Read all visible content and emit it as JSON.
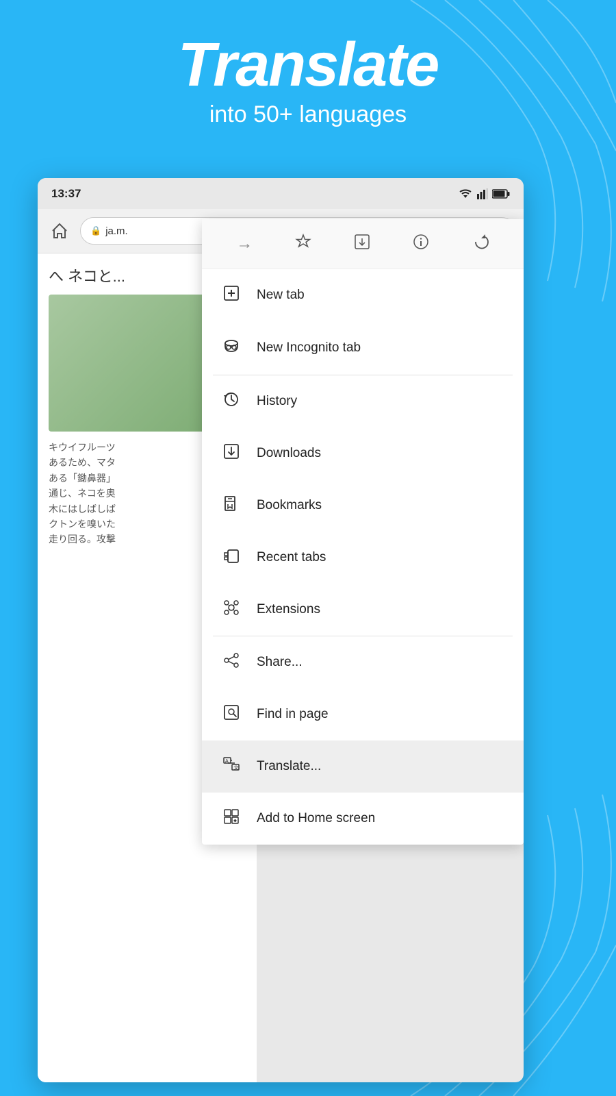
{
  "header": {
    "title": "Translate",
    "subtitle": "into 50+ languages"
  },
  "status_bar": {
    "time": "13:37"
  },
  "address_bar": {
    "url": "ja.m."
  },
  "page_content": {
    "title": "へ ネコと...",
    "body_text": "キウイフルーツ あるため、マタ ある「鋤鼻器」 通じ、ネコを奥 木にはしばしば クトンを嗅いた 走り回る。攻撃"
  },
  "dropdown": {
    "toolbar_icons": [
      {
        "name": "forward-icon",
        "symbol": "→"
      },
      {
        "name": "star-icon",
        "symbol": "☆"
      },
      {
        "name": "download-page-icon",
        "symbol": "⬇"
      },
      {
        "name": "info-icon",
        "symbol": "ℹ"
      },
      {
        "name": "refresh-icon",
        "symbol": "↻"
      }
    ],
    "menu_items": [
      {
        "id": "new-tab",
        "label": "New tab",
        "icon_name": "new-tab-icon"
      },
      {
        "id": "new-incognito-tab",
        "label": "New Incognito tab",
        "icon_name": "incognito-icon"
      },
      {
        "id": "history",
        "label": "History",
        "icon_name": "history-icon"
      },
      {
        "id": "downloads",
        "label": "Downloads",
        "icon_name": "downloads-icon"
      },
      {
        "id": "bookmarks",
        "label": "Bookmarks",
        "icon_name": "bookmarks-icon"
      },
      {
        "id": "recent-tabs",
        "label": "Recent tabs",
        "icon_name": "recent-tabs-icon"
      },
      {
        "id": "extensions",
        "label": "Extensions",
        "icon_name": "extensions-icon"
      },
      {
        "id": "share",
        "label": "Share...",
        "icon_name": "share-icon"
      },
      {
        "id": "find-in-page",
        "label": "Find in page",
        "icon_name": "find-icon"
      },
      {
        "id": "translate",
        "label": "Translate...",
        "icon_name": "translate-icon",
        "active": true
      },
      {
        "id": "add-to-home",
        "label": "Add to Home screen",
        "icon_name": "add-home-icon"
      }
    ]
  },
  "colors": {
    "bg_blue": "#29b6f6",
    "menu_bg": "#ffffff",
    "active_item": "#eeeeee",
    "divider": "#e0e0e0"
  }
}
